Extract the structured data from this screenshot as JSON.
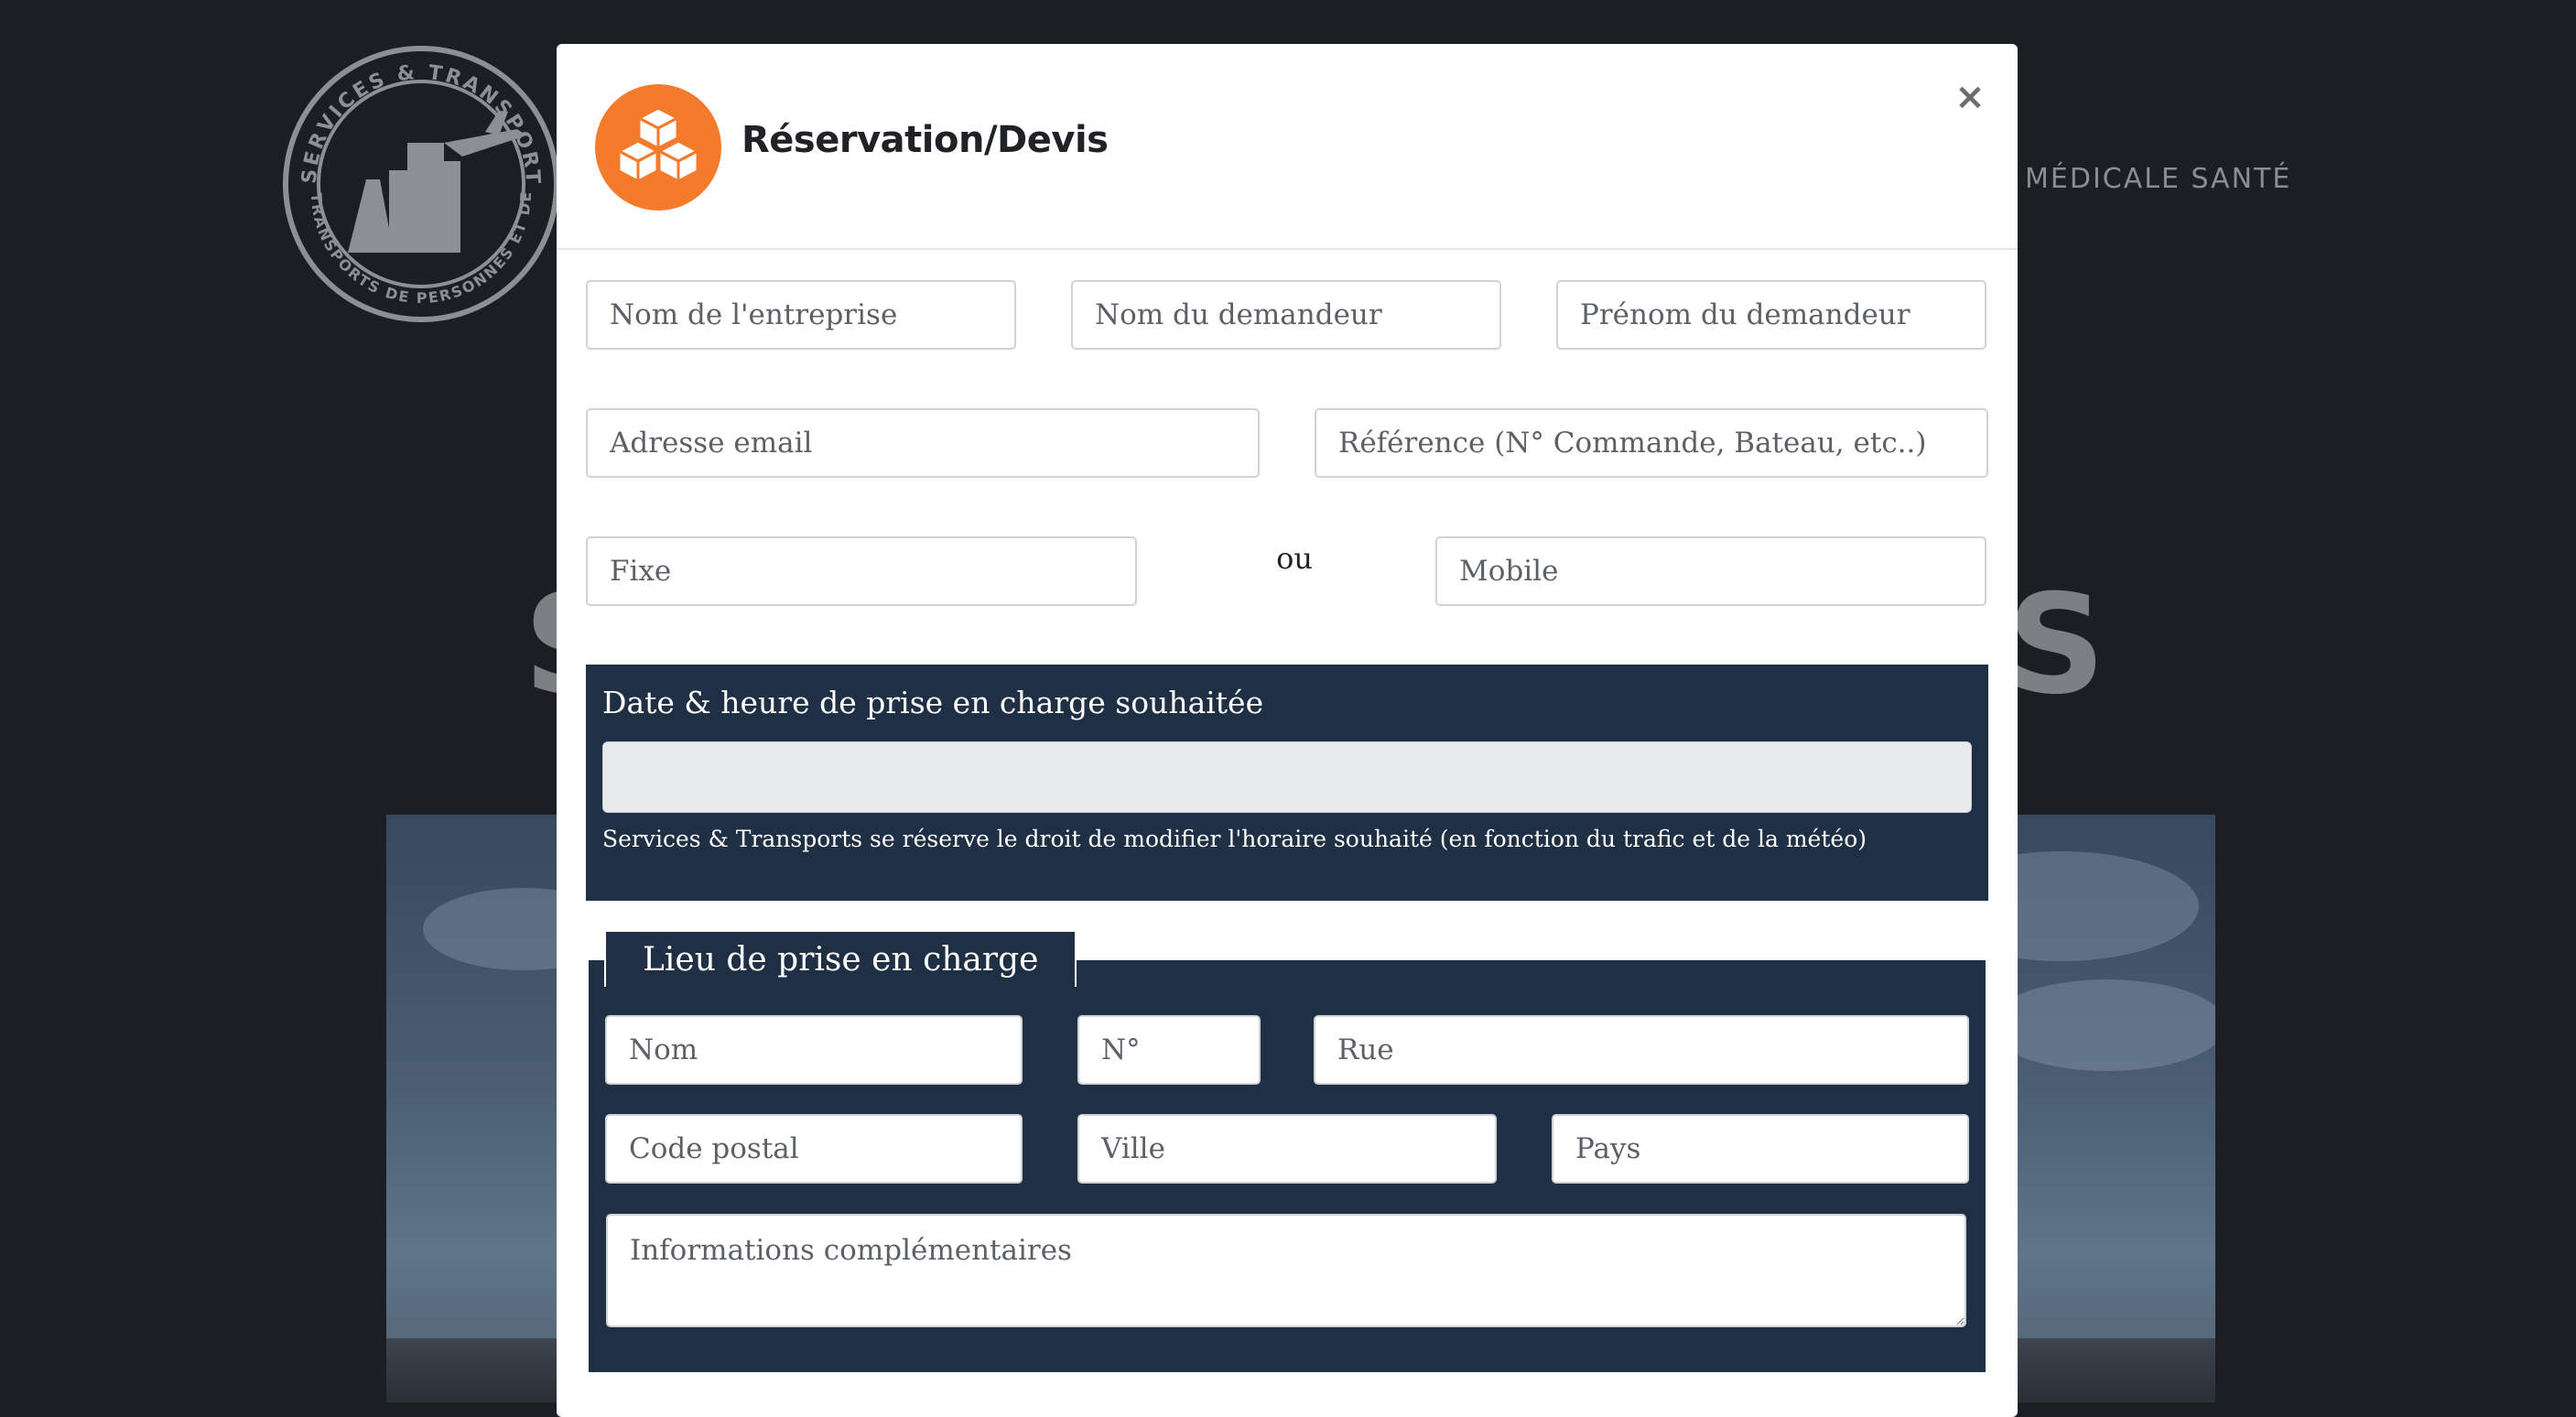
{
  "background": {
    "nav_item": "MÉDICALE SANTÉ",
    "hero_letter_left": "S",
    "hero_letter_right": "S",
    "logo_text_top": "SERVICES & TRANSPORTS",
    "logo_text_bottom": "TRANSPORTS DE PERSONNES ET DE"
  },
  "modal": {
    "title": "Réservation/Devis",
    "close_label": "×",
    "brand_icon": "boxes-icon",
    "fields": {
      "company": "Nom de l'entreprise",
      "requester_last_name": "Nom du demandeur",
      "requester_first_name": "Prénom du demandeur",
      "email": "Adresse email",
      "reference": "Référence (N° Commande, Bateau, etc..)",
      "landline": "Fixe",
      "or": "ou",
      "mobile": "Mobile"
    },
    "date_section": {
      "title": "Date & heure de prise en charge souhaitée",
      "value": "",
      "note": "Services & Transports se réserve le droit de modifier l'horaire souhaité (en fonction du trafic et de la météo)"
    },
    "pickup_section": {
      "legend": "Lieu de prise en charge",
      "name": "Nom",
      "number": "N°",
      "street": "Rue",
      "postal_code": "Code postal",
      "city": "Ville",
      "country": "Pays",
      "additional_info": "Informations complémentaires"
    }
  },
  "colors": {
    "accent": "#f47b2b",
    "section_bg": "#1f3044",
    "page_bg": "#1b1f23"
  }
}
